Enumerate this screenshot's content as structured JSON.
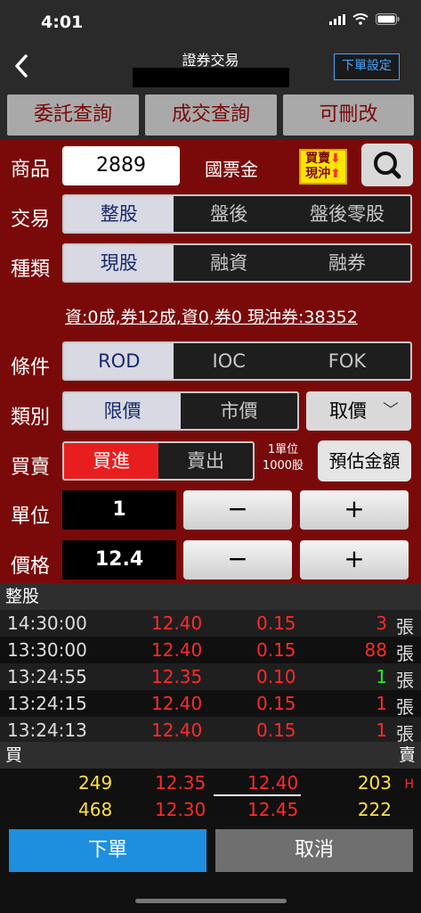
{
  "status": {
    "time": "4:01"
  },
  "nav": {
    "title": "證券交易",
    "order_setting": "下單設定"
  },
  "query_buttons": [
    "委託查詢",
    "成交查詢",
    "可刪改"
  ],
  "form": {
    "product_label": "商品",
    "product_code": "2889",
    "product_name": "國票金",
    "daytrade_badge_line1": "買賣",
    "daytrade_badge_line2": "現沖",
    "trade_label": "交易",
    "trade_options": [
      "整股",
      "盤後",
      "盤後零股"
    ],
    "kind_label": "種類",
    "kind_options": [
      "現股",
      "融資",
      "融券"
    ],
    "summary": "資:0成,券12成,資0,券0 現沖券:38352",
    "cond_label": "條件",
    "cond_options": [
      "ROD",
      "IOC",
      "FOK"
    ],
    "ptype_label": "類別",
    "ptype_options": [
      "限價",
      "市價"
    ],
    "price_mode": "取價",
    "side_label": "買賣",
    "side_options": [
      "買進",
      "賣出"
    ],
    "unit_note_line1": "1單位",
    "unit_note_line2": "1000股",
    "estimate": "預估金額",
    "unit_label": "單位",
    "unit_value": "1",
    "price_label": "價格",
    "price_value": "12.4",
    "minus": "−",
    "plus": "+"
  },
  "ticks": {
    "header": "整股",
    "rows": [
      {
        "time": "14:30:00",
        "price": "12.40",
        "change": "0.15",
        "qty": "3",
        "qty_color": "red",
        "unit": "張"
      },
      {
        "time": "13:30:00",
        "price": "12.40",
        "change": "0.15",
        "qty": "88",
        "qty_color": "red",
        "unit": "張"
      },
      {
        "time": "13:24:55",
        "price": "12.35",
        "change": "0.10",
        "qty": "1",
        "qty_color": "green",
        "unit": "張"
      },
      {
        "time": "13:24:15",
        "price": "12.40",
        "change": "0.15",
        "qty": "1",
        "qty_color": "red",
        "unit": "張"
      },
      {
        "time": "13:24:13",
        "price": "12.40",
        "change": "0.15",
        "qty": "1",
        "qty_color": "red",
        "unit": "張"
      }
    ]
  },
  "book": {
    "buy_label": "買",
    "sell_label": "賣",
    "rows": [
      {
        "bid_qty": "249",
        "bid": "12.35",
        "ask": "12.40",
        "ask_qty": "203",
        "flag": "H"
      },
      {
        "bid_qty": "468",
        "bid": "12.30",
        "ask": "12.45",
        "ask_qty": "222",
        "flag": ""
      }
    ]
  },
  "bottom": {
    "submit": "下單",
    "cancel": "取消"
  },
  "colors": {
    "form_bg": "#7a0a0a",
    "buy_red": "#e81e1e",
    "submit_blue": "#1e8fde",
    "accent_blue": "#4aa3ff"
  }
}
